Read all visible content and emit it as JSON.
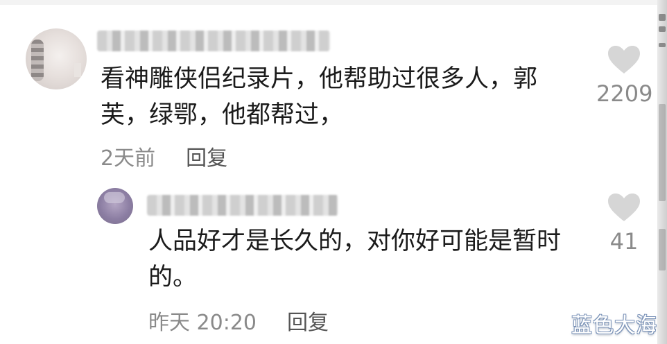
{
  "comments": [
    {
      "text": "看神雕侠侣纪录片，他帮助过很多人，郭芙，绿鄂，他都帮过，",
      "time": "2天前",
      "reply_label": "回复",
      "likes": "2209"
    },
    {
      "text": "人品好才是长久的，对你好可能是暂时的。",
      "time": "昨天 20:20",
      "reply_label": "回复",
      "likes": "41"
    }
  ],
  "watermark": "蓝色大海",
  "colors": {
    "text": "#1b1b1b",
    "meta": "#8a8a8a",
    "heart": "#d6d6d6"
  },
  "icons": {
    "like": "heart-icon"
  }
}
